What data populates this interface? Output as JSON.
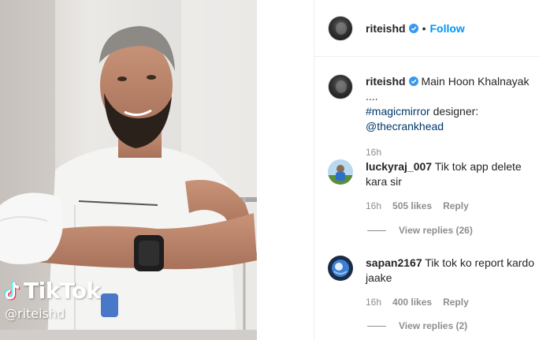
{
  "video": {
    "watermark_text": "TikTok",
    "watermark_handle": "@riteishd"
  },
  "header": {
    "username": "riteishd",
    "dot": "•",
    "follow_label": "Follow"
  },
  "caption": {
    "username": "riteishd",
    "text": "Main Hoon Khalnayak ....",
    "hashtag": "#magicmirror",
    "designer_label": "designer:",
    "mention": "@thecrankhead",
    "time": "16h"
  },
  "comments": [
    {
      "username": "luckyraj_007",
      "text": "Tik tok app delete kara sir",
      "time": "16h",
      "likes": "505 likes",
      "reply_label": "Reply",
      "view_replies": "View replies (26)"
    },
    {
      "username": "sapan2167",
      "text": "Tik tok ko report kardo jaake",
      "time": "16h",
      "likes": "400 likes",
      "reply_label": "Reply",
      "view_replies": "View replies (2)"
    }
  ],
  "colors": {
    "accent": "#0095f6",
    "link": "#00376b",
    "muted": "#8e8e8e",
    "text": "#262626"
  }
}
